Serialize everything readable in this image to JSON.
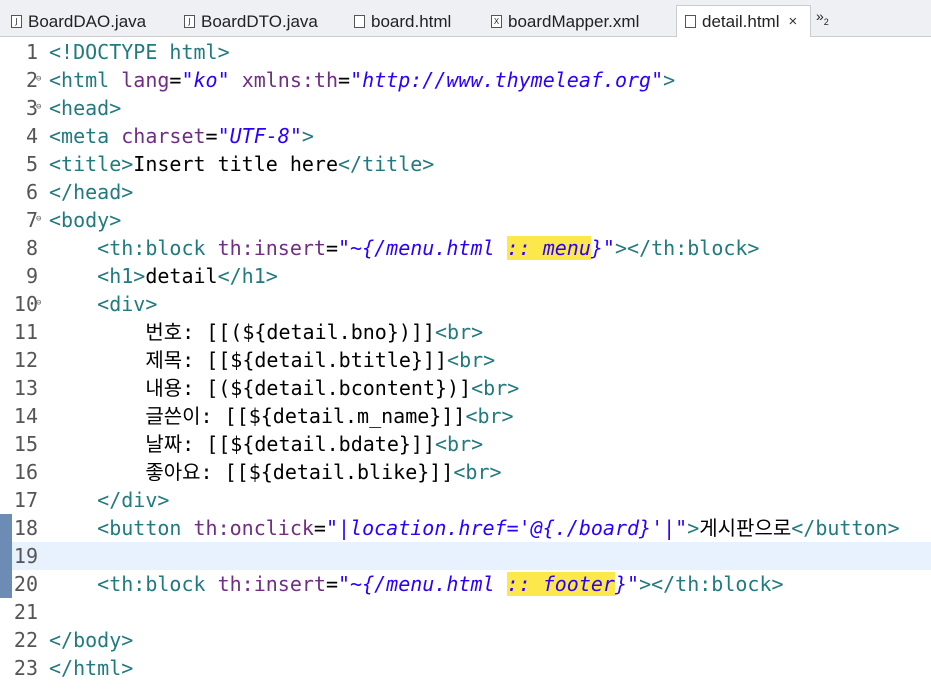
{
  "tabs": [
    {
      "label": "BoardDAO.java",
      "icon": "java-file-icon",
      "glyph": "J"
    },
    {
      "label": "BoardDTO.java",
      "icon": "java-file-icon",
      "glyph": "J"
    },
    {
      "label": "board.html",
      "icon": "html-file-icon",
      "glyph": ""
    },
    {
      "label": "boardMapper.xml",
      "icon": "xml-file-icon",
      "glyph": "X"
    },
    {
      "label": "detail.html",
      "icon": "html-file-icon",
      "glyph": "",
      "close": "×"
    }
  ],
  "overflow": {
    "glyph": "»",
    "count": "2"
  },
  "lines": [
    {
      "n": "1",
      "segs": [
        [
          "t",
          "<!DOCTYPE html>"
        ]
      ]
    },
    {
      "n": "2",
      "fold": "⊖",
      "segs": [
        [
          "t",
          "<html "
        ],
        [
          "a",
          "lang"
        ],
        [
          "",
          "="
        ],
        [
          "v",
          "\"ko\""
        ],
        [
          "",
          " "
        ],
        [
          "a",
          "xmlns:th"
        ],
        [
          "",
          "="
        ],
        [
          "v",
          "\"http://www.thymeleaf.org\""
        ],
        [
          "t",
          ">"
        ]
      ]
    },
    {
      "n": "3",
      "fold": "⊖",
      "segs": [
        [
          "t",
          "<head>"
        ]
      ]
    },
    {
      "n": "4",
      "segs": [
        [
          "t",
          "<meta "
        ],
        [
          "a",
          "charset"
        ],
        [
          "",
          "="
        ],
        [
          "v",
          "\"UTF-8\""
        ],
        [
          "t",
          ">"
        ]
      ]
    },
    {
      "n": "5",
      "segs": [
        [
          "t",
          "<title>"
        ],
        [
          "",
          "Insert title here"
        ],
        [
          "t",
          "</title>"
        ]
      ]
    },
    {
      "n": "6",
      "segs": [
        [
          "t",
          "</head>"
        ]
      ]
    },
    {
      "n": "7",
      "fold": "⊖",
      "segs": [
        [
          "t",
          "<body>"
        ]
      ]
    },
    {
      "n": "8",
      "segs": [
        [
          "",
          "    "
        ],
        [
          "t",
          "<th:block "
        ],
        [
          "a",
          "th:insert"
        ],
        [
          "",
          "="
        ],
        [
          "v",
          "\"~{/menu.html "
        ],
        [
          "vh",
          ":: menu"
        ],
        [
          "v",
          "}\""
        ],
        [
          "t",
          "></th:block>"
        ]
      ]
    },
    {
      "n": "9",
      "segs": [
        [
          "",
          "    "
        ],
        [
          "t",
          "<h1>"
        ],
        [
          "",
          "detail"
        ],
        [
          "t",
          "</h1>"
        ]
      ]
    },
    {
      "n": "10",
      "fold": "⊖",
      "segs": [
        [
          "",
          "    "
        ],
        [
          "t",
          "<div>"
        ]
      ]
    },
    {
      "n": "11",
      "segs": [
        [
          "",
          "        번호: [[(${detail.bno})]]"
        ],
        [
          "t",
          "<br>"
        ]
      ]
    },
    {
      "n": "12",
      "segs": [
        [
          "",
          "        제목: [[${detail.btitle}]]"
        ],
        [
          "t",
          "<br>"
        ]
      ]
    },
    {
      "n": "13",
      "segs": [
        [
          "",
          "        내용: [(${detail.bcontent})]"
        ],
        [
          "t",
          "<br>"
        ]
      ]
    },
    {
      "n": "14",
      "segs": [
        [
          "",
          "        글쓴이: [[${detail.m_name}]]"
        ],
        [
          "t",
          "<br>"
        ]
      ]
    },
    {
      "n": "15",
      "segs": [
        [
          "",
          "        날짜: [[${detail.bdate}]]"
        ],
        [
          "t",
          "<br>"
        ]
      ]
    },
    {
      "n": "16",
      "segs": [
        [
          "",
          "        좋아요: [[${detail.blike}]]"
        ],
        [
          "t",
          "<br>"
        ]
      ]
    },
    {
      "n": "17",
      "segs": [
        [
          "",
          "    "
        ],
        [
          "t",
          "</div>"
        ]
      ]
    },
    {
      "n": "18",
      "mark": true,
      "segs": [
        [
          "",
          "    "
        ],
        [
          "t",
          "<button "
        ],
        [
          "a",
          "th:onclick"
        ],
        [
          "",
          "="
        ],
        [
          "v",
          "\"|location.href='@{./board}'|\""
        ],
        [
          "t",
          ">"
        ],
        [
          "",
          "게시판으로"
        ],
        [
          "t",
          "</button>"
        ]
      ]
    },
    {
      "n": "19",
      "mark": true,
      "current": true,
      "segs": []
    },
    {
      "n": "20",
      "mark": true,
      "segs": [
        [
          "",
          "    "
        ],
        [
          "t",
          "<th:block "
        ],
        [
          "a",
          "th:insert"
        ],
        [
          "",
          "="
        ],
        [
          "v",
          "\"~{/menu.html "
        ],
        [
          "vh",
          ":: footer"
        ],
        [
          "v",
          "}\""
        ],
        [
          "t",
          "></th:block>"
        ]
      ]
    },
    {
      "n": "21",
      "segs": []
    },
    {
      "n": "22",
      "segs": [
        [
          "t",
          "</body>"
        ]
      ]
    },
    {
      "n": "23",
      "segs": [
        [
          "t",
          "</html>"
        ]
      ]
    }
  ]
}
